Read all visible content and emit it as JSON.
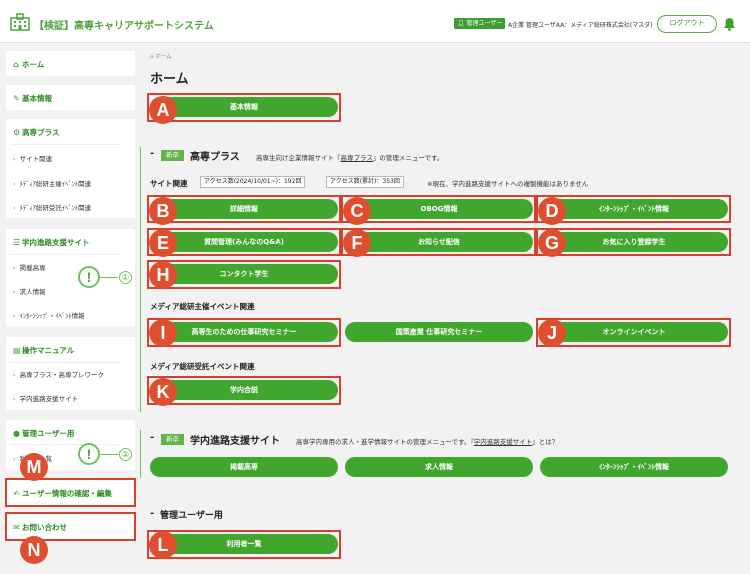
{
  "header": {
    "title": "【検証】高専キャリアサポートシステム",
    "role_badge": "管理ユーザー",
    "user_info": "A企業 管理ユーザAA：メディア総研株式会社(マスダ)",
    "logout_label": "ログアウト"
  },
  "sidebar": {
    "home": "ホーム",
    "basic_info": "基本情報",
    "kosen_plus": {
      "heading": "高専プラス",
      "items": [
        "サイト関連",
        "ﾒﾃﾞｨｱ総研主催ｲﾍﾞﾝﾄ関連",
        "ﾒﾃﾞｨｱ総研受託ｲﾍﾞﾝﾄ関連"
      ]
    },
    "gakunai": {
      "heading": "学内進路支援サイト",
      "items": [
        "掲載高専",
        "求人情報",
        "ｲﾝﾀｰﾝｼｯﾌﾟ・ｲﾍﾞﾝﾄ情報"
      ]
    },
    "manual": {
      "heading": "操作マニュアル",
      "items": [
        "高専プラス・高専プレワーク",
        "学内進路支援サイト"
      ]
    },
    "admin": {
      "heading": "管理ユーザー用",
      "items": [
        "利用者一覧"
      ]
    },
    "user_confirm": "ユーザー情報の確認・編集",
    "contact": "お問い合わせ"
  },
  "main": {
    "breadcrumb": "ホーム",
    "page_title": "ホーム",
    "basic_info_button": "基本情報",
    "kosen_plus": {
      "badge": "新卒",
      "title": "高専プラス",
      "desc_prefix": "高専生向け企業情報サイト『",
      "desc_link": "高専プラス",
      "desc_suffix": "』の管理メニューです。",
      "site_group": "サイト関連",
      "access_period": "アクセス数(2024/10/01~)：192回",
      "access_total": "アクセス数(累計)：353回",
      "note": "※現在、学内進路支援サイトへの複製機能はありません",
      "site_buttons": [
        "詳細情報",
        "OBOG情報",
        "ｲﾝﾀｰﾝｼｯﾌﾟ・ｲﾍﾞﾝﾄ情報",
        "質問管理(みんなのQ&A)",
        "お知らせ配信",
        "お気に入り登録学生",
        "コンタクト学生"
      ],
      "hosted_group": "メディア総研主催イベント関連",
      "hosted_buttons": [
        "高専生のための仕事研究セミナー",
        "国策産業 仕事研究セミナー",
        "オンラインイベント"
      ],
      "commissioned_group": "メディア総研受託イベント関連",
      "commissioned_buttons": [
        "学内合説"
      ]
    },
    "gakunai": {
      "badge": "新卒",
      "title": "学内進路支援サイト",
      "desc_prefix": "高専学内専用の求人・進学情報サイトの管理メニューです。『",
      "desc_link": "学内進路支援サイト",
      "desc_suffix": "』とは？",
      "buttons": [
        "掲載高専",
        "求人情報",
        "ｲﾝﾀｰﾝｼｯﾌﾟ・ｲﾍﾞﾝﾄ情報"
      ]
    },
    "admin": {
      "title": "管理ユーザー用",
      "button": "利用者一覧"
    }
  },
  "annotations": {
    "letters": [
      "A",
      "B",
      "C",
      "D",
      "E",
      "F",
      "G",
      "H",
      "I",
      "J",
      "K",
      "L",
      "M",
      "N"
    ],
    "alerts": [
      "!",
      "!"
    ],
    "alert_numbers": [
      "①",
      "②"
    ]
  },
  "colors": {
    "green": "#41a62e",
    "red_marker": "#dd4f2f",
    "red_box": "#d6402c"
  }
}
